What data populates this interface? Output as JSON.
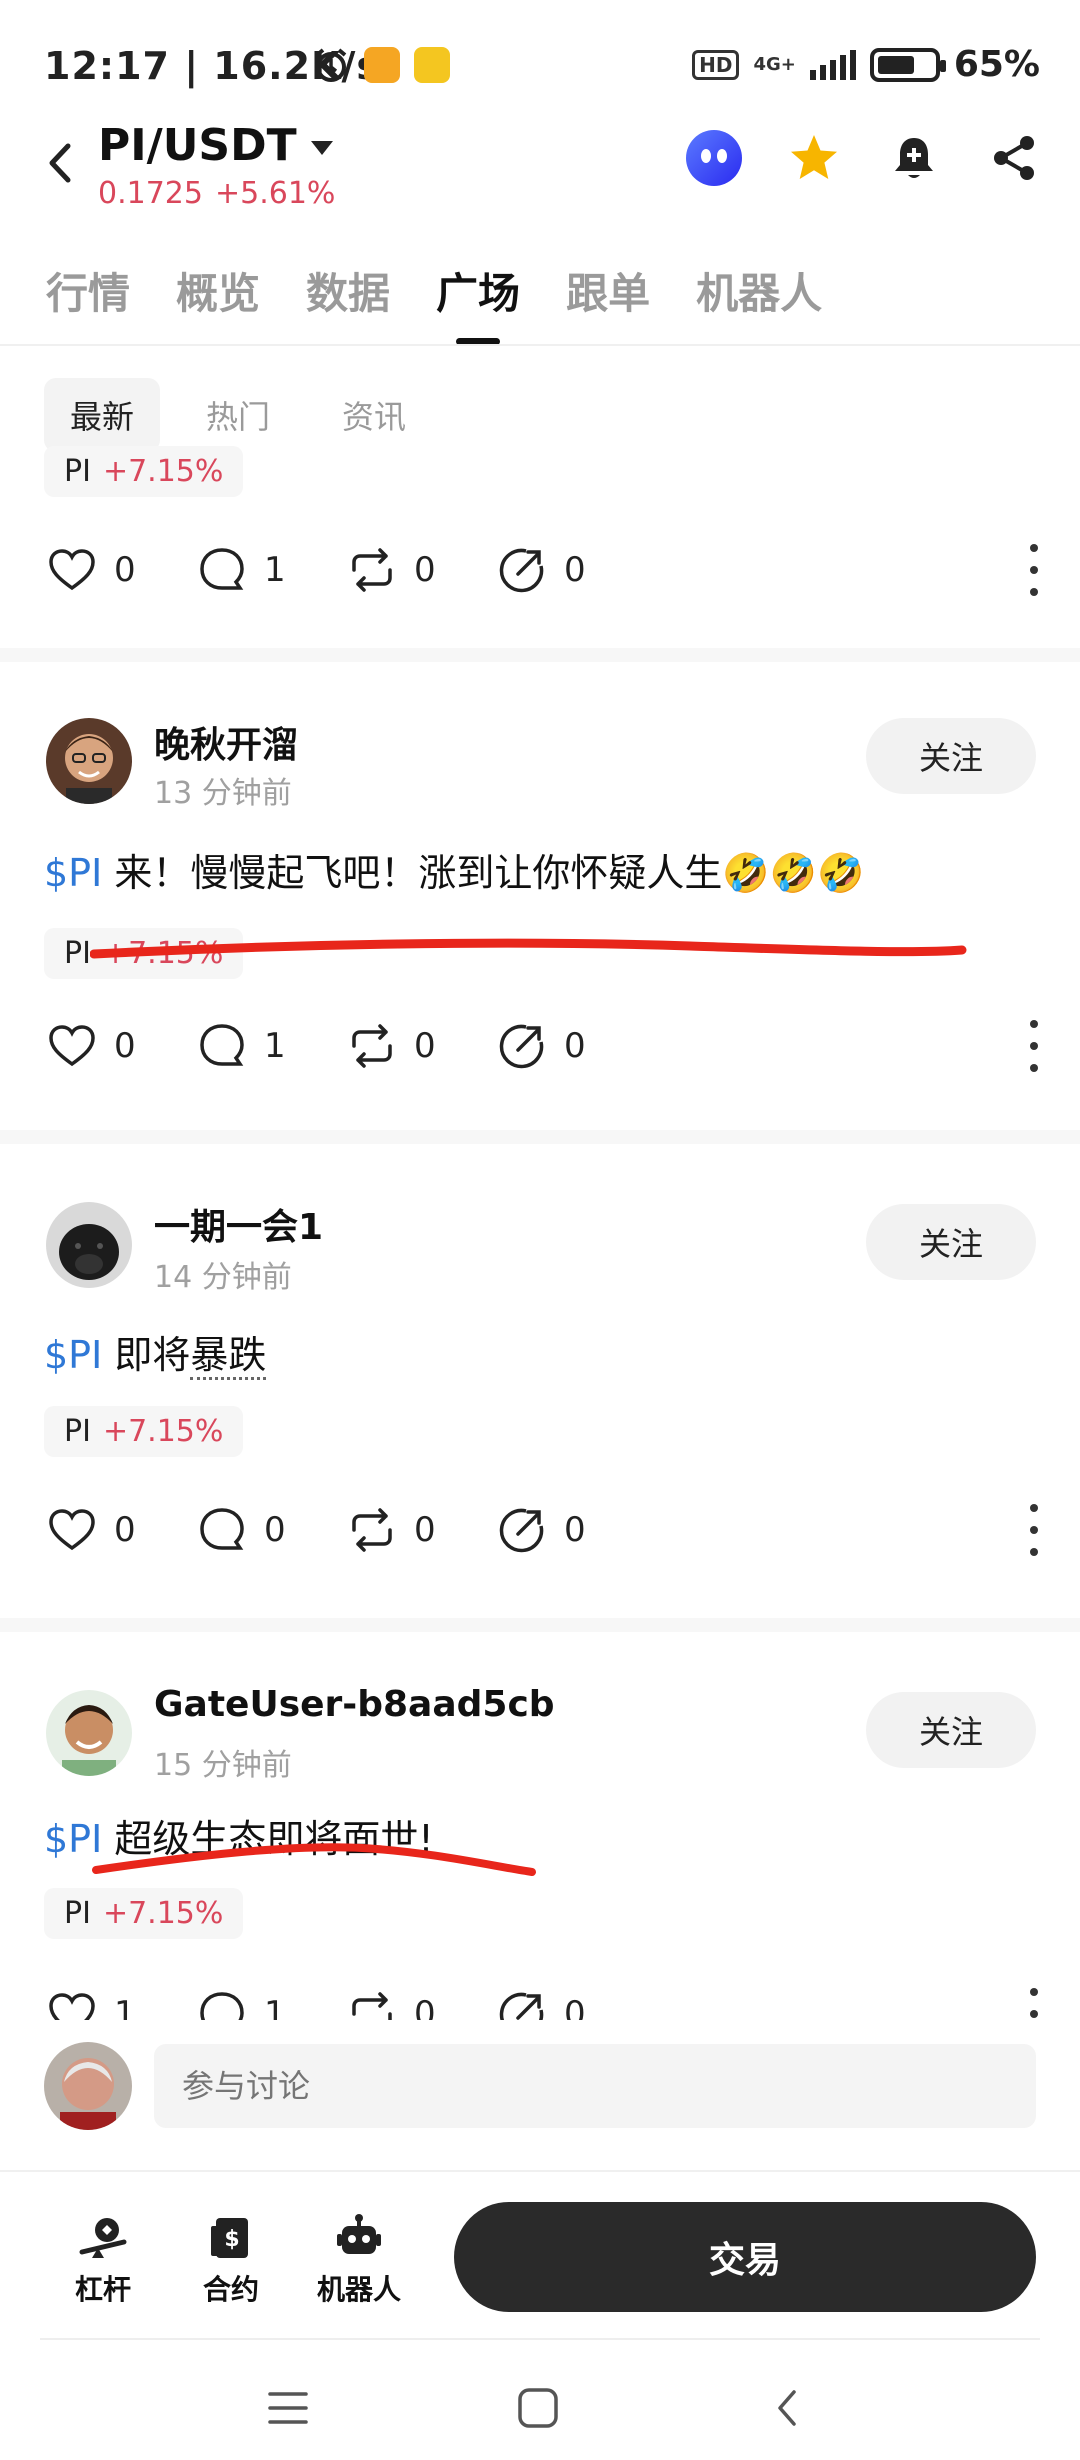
{
  "status_bar": {
    "time_speed": "12:17 | 16.2K/s",
    "network": "4G+",
    "hd": "HD",
    "battery": "65%"
  },
  "header": {
    "pair": "PI/USDT",
    "price": "0.1725",
    "change": "+5.61%"
  },
  "tabs": [
    "行情",
    "概览",
    "数据",
    "广场",
    "跟单",
    "机器人"
  ],
  "active_tab": "广场",
  "subtabs": [
    "最新",
    "热门",
    "资讯"
  ],
  "active_subtab": "最新",
  "posts": [
    {
      "chip_name": "PI",
      "chip_change": "+7.15%",
      "likes": "0",
      "comments": "1",
      "reposts": "0",
      "shares": "0"
    },
    {
      "author": "晚秋开溜",
      "time": "13 分钟前",
      "follow": "关注",
      "tag": "$PI",
      "text": "来！慢慢起飞吧！涨到让你怀疑人生🤣🤣🤣",
      "chip_name": "PI",
      "chip_change": "+7.15%",
      "likes": "0",
      "comments": "1",
      "reposts": "0",
      "shares": "0"
    },
    {
      "author": "一期一会1",
      "time": "14 分钟前",
      "follow": "关注",
      "tag": "$PI",
      "text_a": "即将",
      "text_b": "暴跌",
      "chip_name": "PI",
      "chip_change": "+7.15%",
      "likes": "0",
      "comments": "0",
      "reposts": "0",
      "shares": "0"
    },
    {
      "author": "GateUser-b8aad5cb",
      "time": "15 分钟前",
      "follow": "关注",
      "tag": "$PI",
      "text": "超级生态即将面世!",
      "chip_name": "PI",
      "chip_change": "+7.15%",
      "likes": "1",
      "comments": "1",
      "reposts": "0",
      "shares": "0"
    }
  ],
  "comment_bar": {
    "placeholder": "参与讨论"
  },
  "bottom_bar": {
    "leverage": "杠杆",
    "contract": "合约",
    "robot": "机器人",
    "trade": "交易"
  },
  "colors": {
    "up_red": "#d9475b",
    "tag_blue": "#2f78d6",
    "annotation_red": "#e8261b"
  }
}
